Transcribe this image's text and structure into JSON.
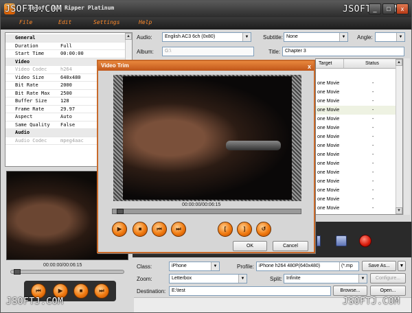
{
  "app": {
    "title": "Xbsoft DVD Ripper Platinum",
    "watermark": "JSOFTJ.COM",
    "window_buttons": [
      "_",
      "□",
      "x"
    ]
  },
  "menu": {
    "items": [
      "File",
      "Edit",
      "Settings",
      "Help"
    ]
  },
  "properties": {
    "rows": [
      {
        "type": "section",
        "key": "General",
        "value": ""
      },
      {
        "type": "row",
        "key": "Duration",
        "value": "Full"
      },
      {
        "type": "row",
        "key": "Start Time",
        "value": "00:00:00"
      },
      {
        "type": "section",
        "key": "Video",
        "value": ""
      },
      {
        "type": "dim",
        "key": "Video Codec",
        "value": "h264"
      },
      {
        "type": "row",
        "key": "Video Size",
        "value": "640x480"
      },
      {
        "type": "row",
        "key": "Bit Rate",
        "value": "2000"
      },
      {
        "type": "row",
        "key": "Bit Rate Max",
        "value": "2500"
      },
      {
        "type": "row",
        "key": "Buffer Size",
        "value": "128"
      },
      {
        "type": "row",
        "key": "Frame Rate",
        "value": "29.97"
      },
      {
        "type": "row",
        "key": "Aspect",
        "value": "Auto"
      },
      {
        "type": "row",
        "key": "Same Quality",
        "value": "False"
      },
      {
        "type": "section",
        "key": "Audio",
        "value": ""
      },
      {
        "type": "dim",
        "key": "Audio Codec",
        "value": "mpeg4aac"
      }
    ]
  },
  "preview": {
    "timecode": "00:00:00/00:06:15",
    "progress_fraction": 0.0
  },
  "top_controls": {
    "audio_label": "Audio:",
    "audio_value": "English AC3 6ch (0x80)",
    "subtitle_label": "Subtitle:",
    "subtitle_value": "None",
    "angle_label": "Angle:",
    "angle_value": "",
    "album_label": "Album:",
    "album_value": "G:\\",
    "title_label": "Title:",
    "title_value": "Chapter 3"
  },
  "table": {
    "headers": [
      "Target",
      "Status"
    ],
    "rows": [
      {
        "target": "",
        "status": ""
      },
      {
        "target": "one Movie",
        "status": "-"
      },
      {
        "target": "one Movie",
        "status": "-"
      },
      {
        "target": "one Movie",
        "status": "-"
      },
      {
        "target": "one Movie",
        "status": "-",
        "selected": true
      },
      {
        "target": "one Movie",
        "status": "-"
      },
      {
        "target": "one Movie",
        "status": "-"
      },
      {
        "target": "one Movie",
        "status": "-"
      },
      {
        "target": "one Movie",
        "status": "-"
      },
      {
        "target": "one Movie",
        "status": "-"
      },
      {
        "target": "one Movie",
        "status": "-"
      },
      {
        "target": "one Movie",
        "status": "-"
      },
      {
        "target": "one Movie",
        "status": "-"
      },
      {
        "target": "one Movie",
        "status": "-"
      },
      {
        "target": "one Movie",
        "status": "-"
      },
      {
        "target": "one Movie",
        "status": "-"
      },
      {
        "target": "one Movie",
        "status": ""
      }
    ]
  },
  "dialog": {
    "title": "Video Trim",
    "close": "x",
    "timecode": "00:00:00/00:06:15",
    "ok_label": "OK",
    "cancel_label": "Cancel"
  },
  "bottom": {
    "class_label": "Class:",
    "class_value": "iPhone",
    "profile_label": "Profile:",
    "profile_value": "iPhone h264 480P(640x480)",
    "profile_ext": "(*.mp",
    "save_as_label": "Save As...",
    "zoom_label": "Zoom:",
    "zoom_value": "Letterbox",
    "split_label": "Split:",
    "split_value": "Infinite",
    "configure_label": "Configure...",
    "destination_label": "Destination:",
    "destination_value": "E:\\test",
    "browse_label": "Browse...",
    "open_label": "Open..."
  },
  "colors": {
    "accent_orange": "#f07a10",
    "menu_text": "#ff8a2a",
    "dialog_border": "#c86a2a"
  }
}
